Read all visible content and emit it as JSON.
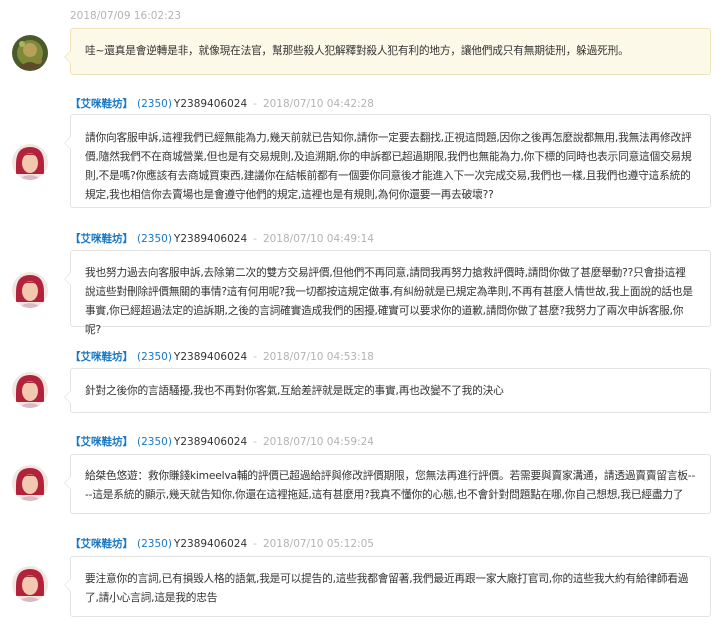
{
  "buyer_message": {
    "timestamp": "2018/07/09 16:02:23",
    "text": "哇~還真是會逆轉是非，就像現在法官，幫那些殺人犯解釋對殺人犯有利的地方，讓他們成只有無期徒刑，躲過死刑。"
  },
  "seller_messages": [
    {
      "shop_name": "【艾咪鞋坊】",
      "user_id": "(2350)",
      "username": "Y2389406024",
      "separator": "-",
      "timestamp": "2018/07/10 04:42:28",
      "text": "請你向客服申訴,這裡我們已經無能為力,幾天前就已告知你,請你一定要去翻找,正視這問題,因你之後再怎麼說都無用,我無法再修改評價,隨然我們不在商城營業,但也是有交易規則,及追溯期,你的申訴都已超過期限,我們也無能為力,你下標的同時也表示同意這個交易規則,不是嗎?你應該有去商城買東西,建議你在結帳前都有一個要你同意後才能進入下一次完成交易,我們也一樣,且我們也遵守這系統的規定,我也相信你去賣場也是會遵守他們的規定,這裡也是有規則,為何你還要一再去破壞??"
    },
    {
      "shop_name": "【艾咪鞋坊】",
      "user_id": "(2350)",
      "username": "Y2389406024",
      "separator": "-",
      "timestamp": "2018/07/10 04:49:14",
      "text": "我也努力過去向客服申訴,去除第二次的雙方交易評價,但他們不再同意,請問我再努力搶救評價時,請問你做了甚麼舉動??只會掛這裡說這些對刪除評價無關的事情?這有何用呢?我一切都按這規定做事,有糾紛就是已規定為準則,不再有甚麼人情世故,我上面說的話也是事實,你已經超過法定的追訴期,之後的言詞確實造成我們的困擾,確實可以要求你的道歉,請問你做了甚麼?我努力了兩次申訴客服,你呢?"
    },
    {
      "shop_name": "【艾咪鞋坊】",
      "user_id": "(2350)",
      "username": "Y2389406024",
      "separator": "-",
      "timestamp": "2018/07/10 04:53:18",
      "text": "針對之後你的言語騷擾,我也不再對你客氣,互給差評就是既定的事實,再也改變不了我的決心"
    },
    {
      "shop_name": "【艾咪鞋坊】",
      "user_id": "(2350)",
      "username": "Y2389406024",
      "separator": "-",
      "timestamp": "2018/07/10 04:59:24",
      "text": "給桀色悠遊：救你賺錢kimeelva輔的評價已超過給評與修改評價期限，您無法再進行評價。若需要與賣家溝通，請透過賣賣留言板----這是系統的顯示,幾天就告知你,你還在這裡拖延,這有甚麼用?我真不懂你的心態,也不會針對問題點在哪,你自己想想,我已經盡力了"
    },
    {
      "shop_name": "【艾咪鞋坊】",
      "user_id": "(2350)",
      "username": "Y2389406024",
      "separator": "-",
      "timestamp": "2018/07/10 05:12:05",
      "text": "要注意你的言詞,已有損毀人格的語氣,我是可以提告的,這些我都會留著,我們最近再跟一家大廠打官司,你的這些我大約有給律師看過了,請小心言詞,這是我的忠告"
    }
  ]
}
